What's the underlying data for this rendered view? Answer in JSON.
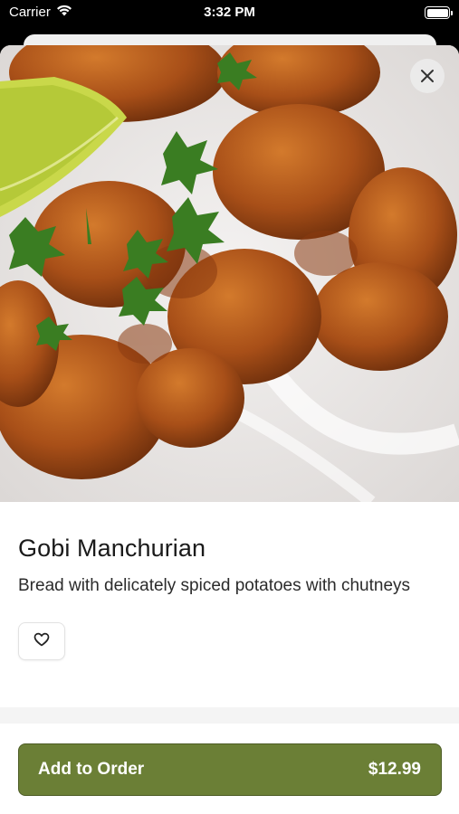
{
  "status_bar": {
    "carrier": "Carrier",
    "time": "3:32 PM"
  },
  "item": {
    "name": "Gobi Manchurian",
    "description": "Bread with delicately spiced potatoes with chutneys"
  },
  "order_button": {
    "label": "Add to Order",
    "price": "$12.99"
  },
  "colors": {
    "accent": "#6b7f36"
  },
  "icons": {
    "close": "close-icon",
    "favorite": "heart-icon",
    "wifi": "wifi-icon",
    "battery": "battery-icon"
  }
}
